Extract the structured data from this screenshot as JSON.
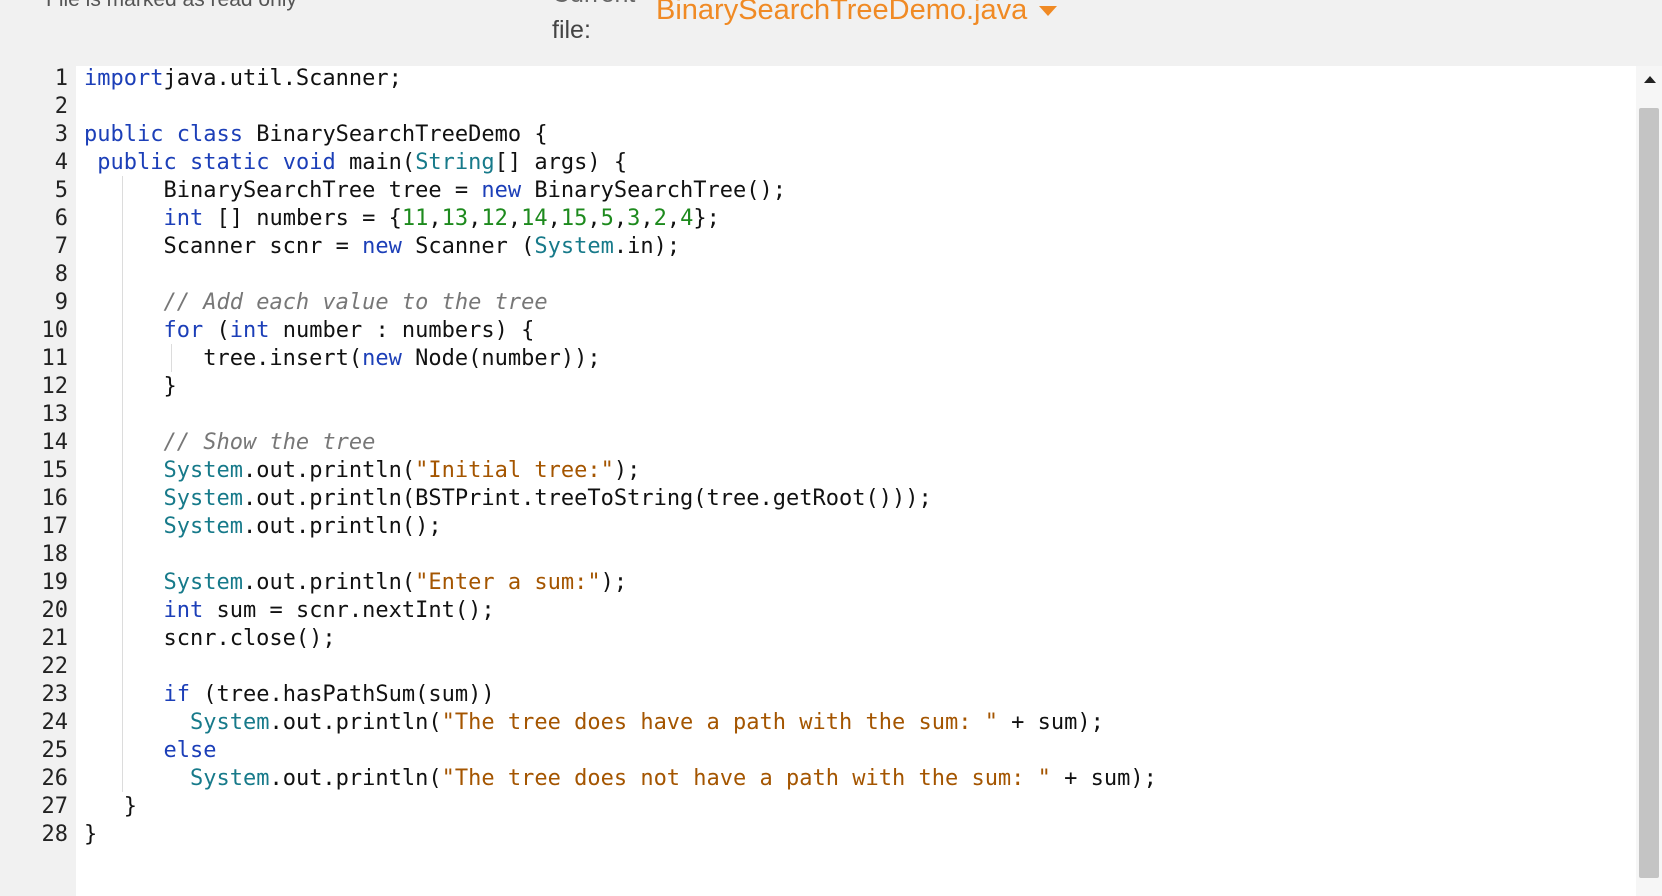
{
  "header": {
    "read_only_note": "File is marked as read only",
    "current_label_top": "Current",
    "file_label": "file:",
    "file_name": "BinarySearchTreeDemo.java",
    "accent_color": "#f08a24"
  },
  "editor": {
    "line_numbers": [
      "1",
      "2",
      "3",
      "4",
      "5",
      "6",
      "7",
      "8",
      "9",
      "10",
      "11",
      "12",
      "13",
      "14",
      "15",
      "16",
      "17",
      "18",
      "19",
      "20",
      "21",
      "22",
      "23",
      "24",
      "25",
      "26",
      "27",
      "28"
    ],
    "lines": [
      [
        [
          "kw",
          "import"
        ],
        [
          "",
          "java.util.Scanner;"
        ]
      ],
      [],
      [
        [
          "kw",
          "public"
        ],
        [
          "",
          " "
        ],
        [
          "kw",
          "class"
        ],
        [
          "",
          " BinarySearchTreeDemo {"
        ]
      ],
      [
        [
          "",
          " "
        ],
        [
          "kw",
          "public"
        ],
        [
          "",
          " "
        ],
        [
          "kw",
          "static"
        ],
        [
          "",
          " "
        ],
        [
          "kw",
          "void"
        ],
        [
          "",
          " main("
        ],
        [
          "ty",
          "String"
        ],
        [
          "",
          "[] args) {"
        ]
      ],
      [
        [
          "",
          "      BinarySearchTree tree = "
        ],
        [
          "kw",
          "new"
        ],
        [
          "",
          " BinarySearchTree();"
        ]
      ],
      [
        [
          "",
          "      "
        ],
        [
          "kw",
          "int"
        ],
        [
          "",
          " [] numbers = {"
        ],
        [
          "num",
          "11"
        ],
        [
          "",
          ","
        ],
        [
          "num",
          "13"
        ],
        [
          "",
          ","
        ],
        [
          "num",
          "12"
        ],
        [
          "",
          ","
        ],
        [
          "num",
          "14"
        ],
        [
          "",
          ","
        ],
        [
          "num",
          "15"
        ],
        [
          "",
          ","
        ],
        [
          "num",
          "5"
        ],
        [
          "",
          ","
        ],
        [
          "num",
          "3"
        ],
        [
          "",
          ","
        ],
        [
          "num",
          "2"
        ],
        [
          "",
          ","
        ],
        [
          "num",
          "4"
        ],
        [
          "",
          "};"
        ]
      ],
      [
        [
          "",
          "      Scanner scnr = "
        ],
        [
          "kw",
          "new"
        ],
        [
          "",
          " Scanner ("
        ],
        [
          "ty",
          "System"
        ],
        [
          "",
          ".in);"
        ]
      ],
      [],
      [
        [
          "",
          "      "
        ],
        [
          "com",
          "// Add each value to the tree"
        ]
      ],
      [
        [
          "",
          "      "
        ],
        [
          "kw",
          "for"
        ],
        [
          "",
          " ("
        ],
        [
          "kw",
          "int"
        ],
        [
          "",
          " number : numbers) {"
        ]
      ],
      [
        [
          "",
          "         tree.insert("
        ],
        [
          "kw",
          "new"
        ],
        [
          "",
          " Node(number));"
        ]
      ],
      [
        [
          "",
          "      }"
        ]
      ],
      [],
      [
        [
          "",
          "      "
        ],
        [
          "com",
          "// Show the tree"
        ]
      ],
      [
        [
          "",
          "      "
        ],
        [
          "ty",
          "System"
        ],
        [
          "",
          ".out.println("
        ],
        [
          "str",
          "\"Initial tree:\""
        ],
        [
          "",
          ");"
        ]
      ],
      [
        [
          "",
          "      "
        ],
        [
          "ty",
          "System"
        ],
        [
          "",
          ".out.println(BSTPrint.treeToString(tree.getRoot()));"
        ]
      ],
      [
        [
          "",
          "      "
        ],
        [
          "ty",
          "System"
        ],
        [
          "",
          ".out.println();"
        ]
      ],
      [],
      [
        [
          "",
          "      "
        ],
        [
          "ty",
          "System"
        ],
        [
          "",
          ".out.println("
        ],
        [
          "str",
          "\"Enter a sum:\""
        ],
        [
          "",
          ");"
        ]
      ],
      [
        [
          "",
          "      "
        ],
        [
          "kw",
          "int"
        ],
        [
          "",
          " sum = scnr.nextInt();"
        ]
      ],
      [
        [
          "",
          "      scnr.close();"
        ]
      ],
      [],
      [
        [
          "",
          "      "
        ],
        [
          "kw",
          "if"
        ],
        [
          "",
          " (tree.hasPathSum(sum))"
        ]
      ],
      [
        [
          "",
          "        "
        ],
        [
          "ty",
          "System"
        ],
        [
          "",
          ".out.println("
        ],
        [
          "str",
          "\"The tree does have a path with the sum: \""
        ],
        [
          "",
          " + sum);"
        ]
      ],
      [
        [
          "",
          "      "
        ],
        [
          "kw",
          "else"
        ]
      ],
      [
        [
          "",
          "        "
        ],
        [
          "ty",
          "System"
        ],
        [
          "",
          ".out.println("
        ],
        [
          "str",
          "\"The tree does not have a path with the sum: \""
        ],
        [
          "",
          " + sum);"
        ]
      ],
      [
        [
          "",
          "   }"
        ]
      ],
      [
        [
          "",
          "}"
        ]
      ]
    ]
  }
}
